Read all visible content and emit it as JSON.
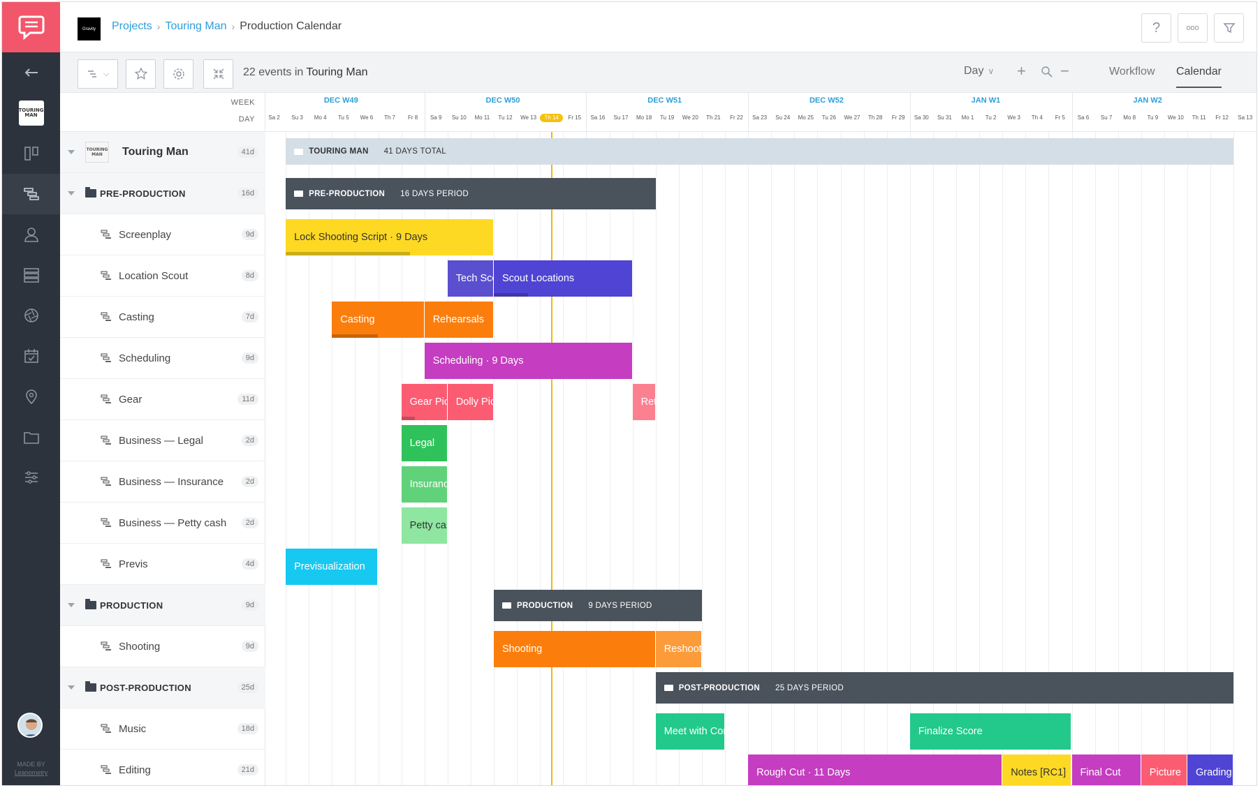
{
  "topbar": {
    "project_logo_text": "Gravity",
    "breadcrumb": [
      "Projects",
      "Touring Man",
      "Production Calendar"
    ],
    "help": "?",
    "more": "ooo"
  },
  "toolbar": {
    "events_count": "22 events in",
    "events_project": "Touring Man",
    "zoom_mode": "Day",
    "tabs": [
      "Workflow",
      "Calendar"
    ],
    "active_tab": "Calendar"
  },
  "panel": {
    "week_label": "WEEK",
    "day_label": "DAY",
    "rows": [
      {
        "label": "Touring Man",
        "badge": "41d",
        "type": "root",
        "thumb": "TOURING MAN"
      },
      {
        "label": "PRE-PRODUCTION",
        "badge": "16d",
        "type": "group"
      },
      {
        "label": "Screenplay",
        "badge": "9d",
        "type": "task"
      },
      {
        "label": "Location Scout",
        "badge": "8d",
        "type": "task"
      },
      {
        "label": "Casting",
        "badge": "7d",
        "type": "task"
      },
      {
        "label": "Scheduling",
        "badge": "9d",
        "type": "task"
      },
      {
        "label": "Gear",
        "badge": "11d",
        "type": "task"
      },
      {
        "label": "Business — Legal",
        "badge": "2d",
        "type": "task"
      },
      {
        "label": "Business — Insurance",
        "badge": "2d",
        "type": "task"
      },
      {
        "label": "Business — Petty cash",
        "badge": "2d",
        "type": "task"
      },
      {
        "label": "Previs",
        "badge": "4d",
        "type": "task"
      },
      {
        "label": "PRODUCTION",
        "badge": "9d",
        "type": "group"
      },
      {
        "label": "Shooting",
        "badge": "9d",
        "type": "task"
      },
      {
        "label": "POST-PRODUCTION",
        "badge": "25d",
        "type": "group"
      },
      {
        "label": "Music",
        "badge": "18d",
        "type": "task"
      },
      {
        "label": "Editing",
        "badge": "21d",
        "type": "task"
      }
    ]
  },
  "timeline": {
    "weeks": [
      {
        "label": "DEC  W49",
        "start": 2
      },
      {
        "label": "DEC  W50",
        "start": 9
      },
      {
        "label": "DEC  W51",
        "start": 16
      },
      {
        "label": "DEC  W52",
        "start": 23
      },
      {
        "label": "JAN  W1",
        "start": 30
      },
      {
        "label": "JAN  W2",
        "start": 37
      }
    ],
    "days": [
      "Sa 2",
      "Su 3",
      "Mo 4",
      "Tu 5",
      "We 6",
      "Th 7",
      "Fr 8",
      "Sa 9",
      "Su 10",
      "Mo 11",
      "Tu 12",
      "We 13",
      "Th 14",
      "Fr 15",
      "Sa 16",
      "Su 17",
      "Mo 18",
      "Tu 19",
      "We 20",
      "Th 21",
      "Fr 22",
      "Sa 23",
      "Su 24",
      "Mo 25",
      "Tu 26",
      "We 27",
      "Th 28",
      "Fr 29",
      "Sa 30",
      "Su 31",
      "Mo 1",
      "Tu 2",
      "We 3",
      "Th 4",
      "Fr 5",
      "Sa 6",
      "Su 7",
      "Mo 8",
      "Tu 9",
      "We 10",
      "Th 11",
      "Fr 12",
      "Sa 13"
    ],
    "today_index": 12,
    "phases": [
      {
        "row": 0,
        "label": "TOURING MAN",
        "sub": "41 DAYS TOTAL",
        "start": 1,
        "len": 41,
        "style": "light"
      },
      {
        "row": 1,
        "label": "PRE-PRODUCTION",
        "sub": "16 DAYS PERIOD",
        "start": 1,
        "len": 16,
        "style": "dark"
      },
      {
        "row": 11,
        "label": "PRODUCTION",
        "sub": "9 DAYS PERIOD",
        "start": 10,
        "len": 9,
        "style": "dark"
      },
      {
        "row": 13,
        "label": "POST-PRODUCTION",
        "sub": "25 DAYS PERIOD",
        "start": 17,
        "len": 25,
        "style": "dark"
      }
    ],
    "bars": [
      {
        "row": 2,
        "label": "Lock Shooting Script · 9 Days",
        "start": 1,
        "len": 9,
        "color": "#fdd924",
        "dark": true,
        "progress": 0.6
      },
      {
        "row": 3,
        "label": "Tech Scout",
        "start": 8,
        "len": 2,
        "color": "#5a4fcf",
        "progress": 0
      },
      {
        "row": 3,
        "label": "Scout Locations",
        "start": 10,
        "len": 6,
        "color": "#4f44d4",
        "progress": 0.25
      },
      {
        "row": 4,
        "label": "Casting",
        "start": 3,
        "len": 4,
        "color": "#fb7e0d",
        "progress": 0.5
      },
      {
        "row": 4,
        "label": "Rehearsals",
        "start": 7,
        "len": 3,
        "color": "#fb7e0d",
        "progress": 0
      },
      {
        "row": 5,
        "label": "Scheduling · 9 Days",
        "start": 7,
        "len": 9,
        "color": "#c53dc1",
        "progress": 0
      },
      {
        "row": 6,
        "label": "Gear Pickup",
        "start": 6,
        "len": 2,
        "color": "#fb5c72",
        "progress": 0.3
      },
      {
        "row": 6,
        "label": "Dolly Pickup",
        "start": 8,
        "len": 2,
        "color": "#fb5c72",
        "progress": 0
      },
      {
        "row": 6,
        "label": "Return",
        "start": 16,
        "len": 1,
        "color": "#fb8090",
        "progress": 0
      },
      {
        "row": 7,
        "label": "Legal",
        "start": 6,
        "len": 2,
        "color": "#2fc25b",
        "progress": 0
      },
      {
        "row": 8,
        "label": "Insurance",
        "start": 6,
        "len": 2,
        "color": "#5fd27a",
        "progress": 0
      },
      {
        "row": 9,
        "label": "Petty cash",
        "start": 6,
        "len": 2,
        "color": "#8ee6a0",
        "dark": true,
        "progress": 0
      },
      {
        "row": 10,
        "label": "Previsualization",
        "start": 1,
        "len": 4,
        "color": "#17c8f0",
        "progress": 0
      },
      {
        "row": 12,
        "label": "Shooting",
        "start": 10,
        "len": 7,
        "color": "#fb7e0d",
        "progress": 0
      },
      {
        "row": 12,
        "label": "Reshoots",
        "start": 17,
        "len": 2,
        "color": "#fb9b3a",
        "progress": 0
      },
      {
        "row": 14,
        "label": "Meet with Composer",
        "start": 17,
        "len": 3,
        "color": "#22c98b",
        "progress": 0
      },
      {
        "row": 14,
        "label": "Finalize Score",
        "start": 28,
        "len": 7,
        "color": "#22c98b",
        "progress": 0
      },
      {
        "row": 15,
        "label": "Rough Cut · 11 Days",
        "start": 21,
        "len": 11,
        "color": "#c53dc1",
        "progress": 0
      },
      {
        "row": 15,
        "label": "Notes [RC1]",
        "start": 32,
        "len": 3,
        "color": "#fdd924",
        "dark": true,
        "progress": 0
      },
      {
        "row": 15,
        "label": "Final Cut",
        "start": 35,
        "len": 3,
        "color": "#c53dc1",
        "progress": 0
      },
      {
        "row": 15,
        "label": "Picture",
        "start": 38,
        "len": 2,
        "color": "#fb5c72",
        "progress": 0
      },
      {
        "row": 15,
        "label": "Grading",
        "start": 40,
        "len": 2,
        "color": "#4f44d4",
        "progress": 0
      }
    ]
  },
  "sidebar": {
    "items": [
      "back-arrow-icon",
      "project-thumb",
      "board-icon",
      "timeline-icon",
      "people-icon",
      "stripboard-icon",
      "aperture-icon",
      "calendar-icon",
      "location-pin-icon",
      "folder-icon",
      "sliders-icon"
    ],
    "thumb_text": "TOURING MAN",
    "made_by": "MADE BY",
    "made_by_company": "Leanometry"
  }
}
